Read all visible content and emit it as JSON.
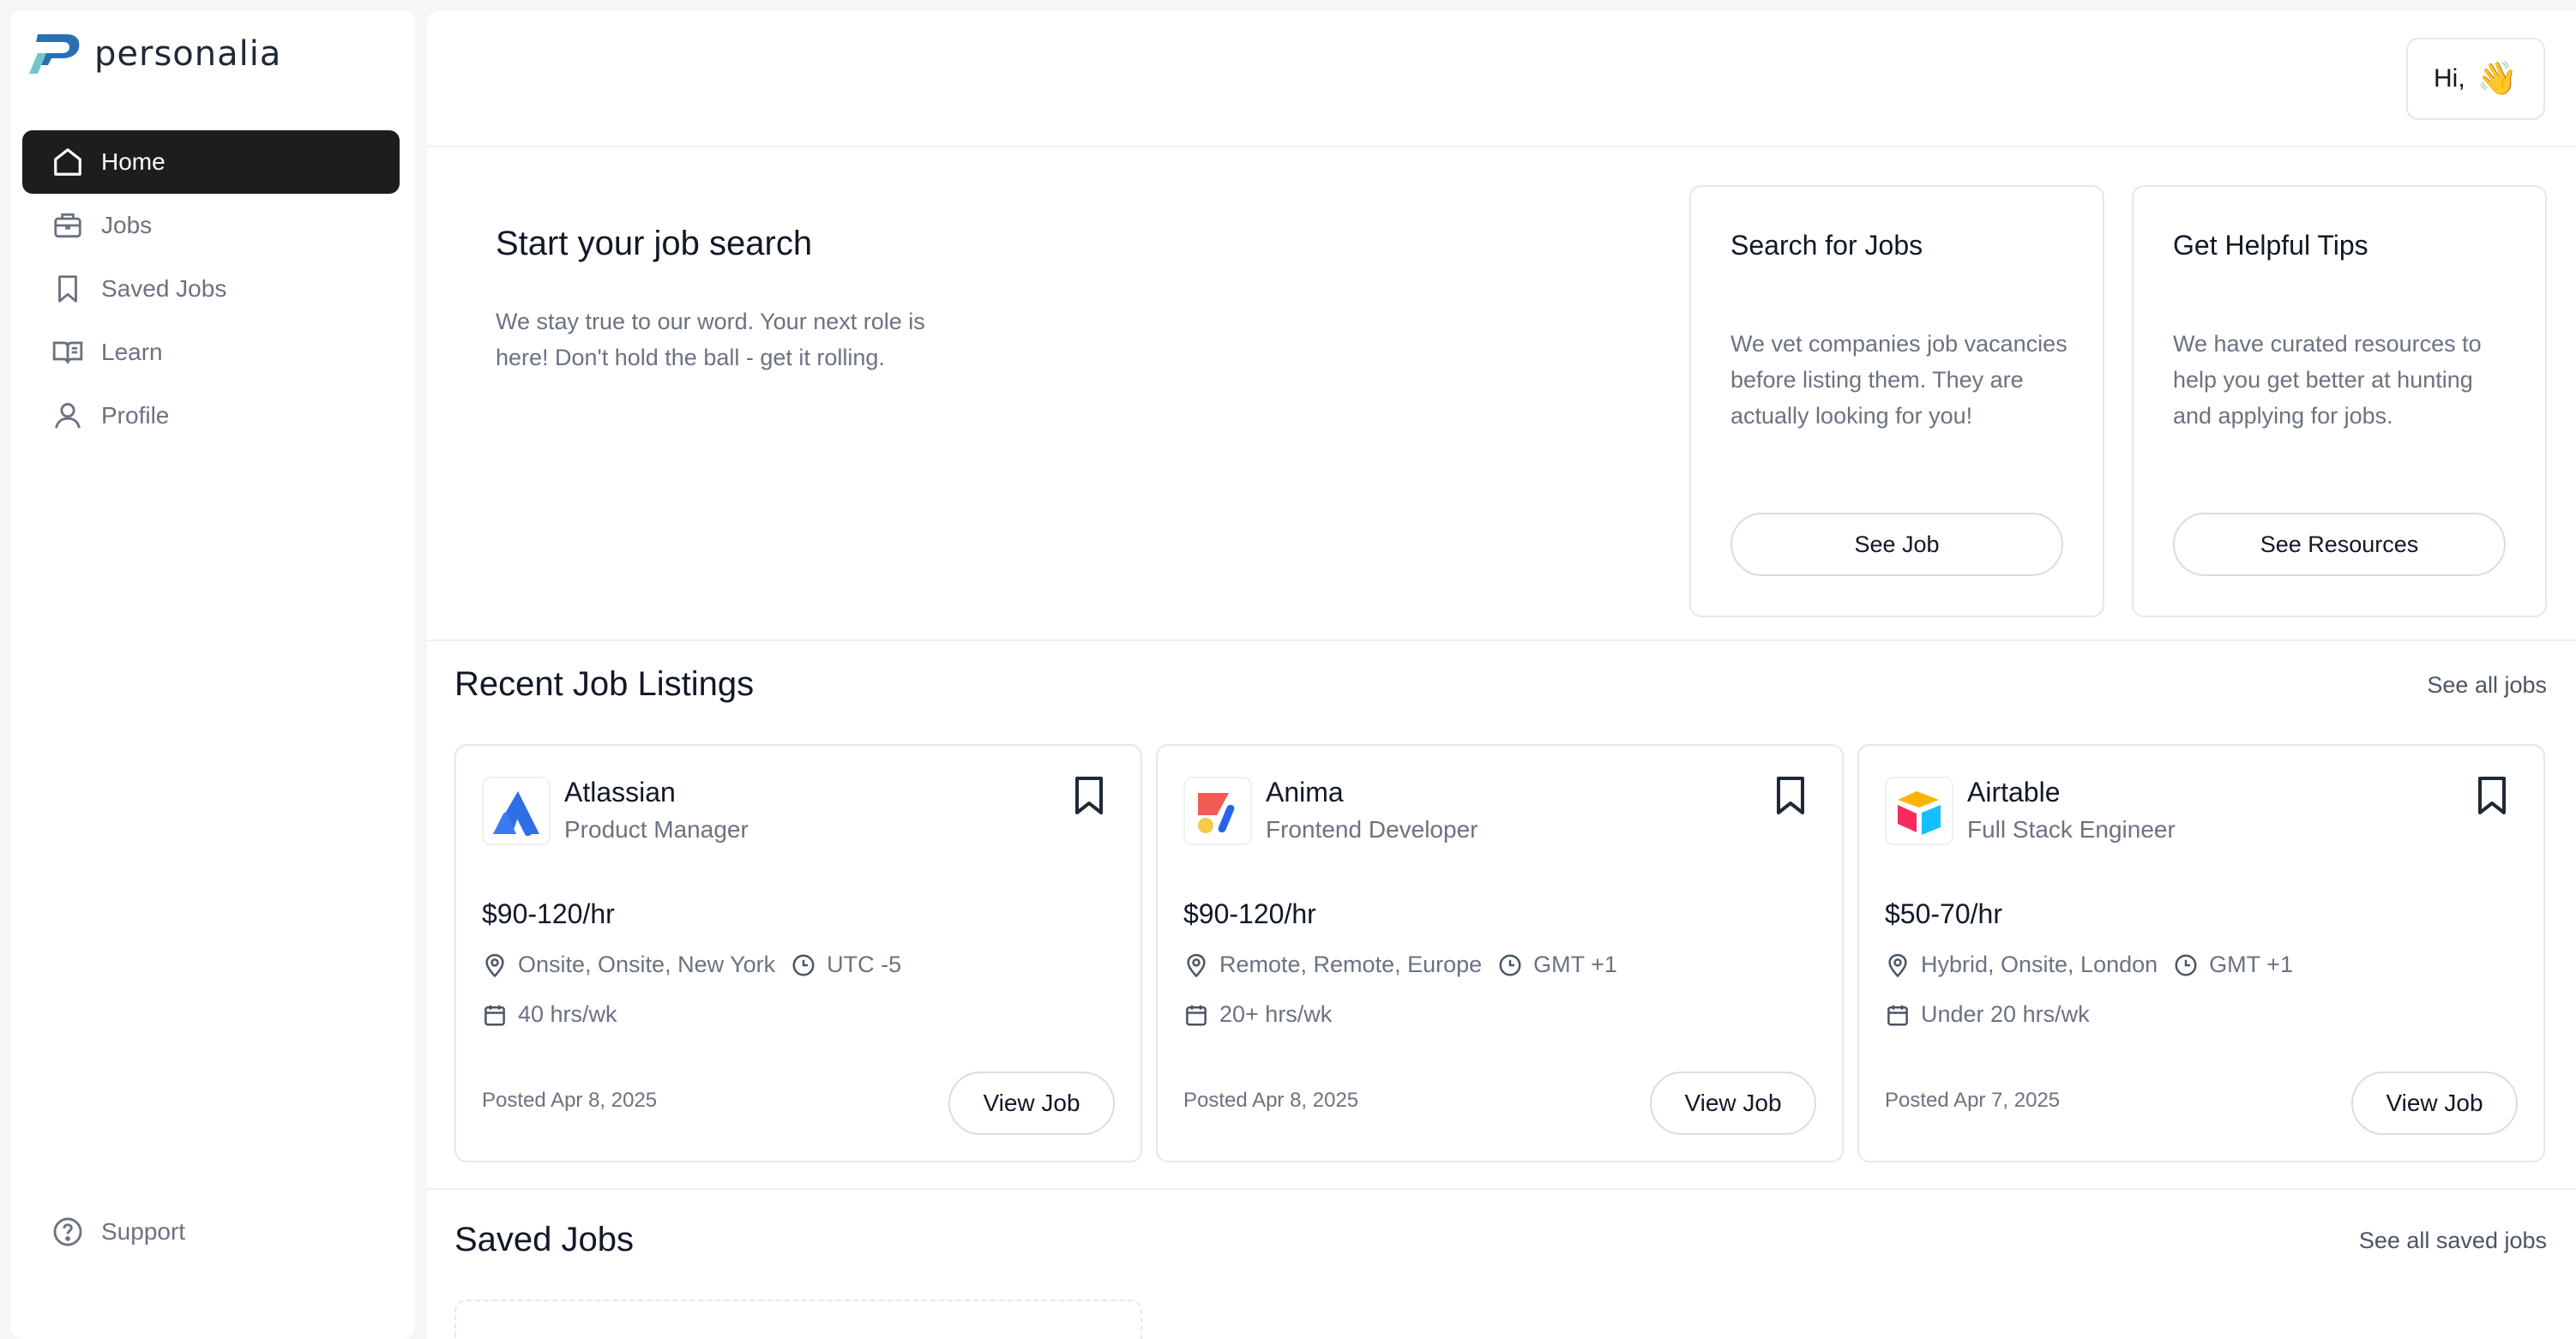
{
  "brand": {
    "name": "personalia"
  },
  "sidebar": {
    "items": [
      {
        "label": "Home",
        "icon": "home-icon",
        "active": true
      },
      {
        "label": "Jobs",
        "icon": "briefcase-icon"
      },
      {
        "label": "Saved Jobs",
        "icon": "bookmark-icon"
      },
      {
        "label": "Learn",
        "icon": "book-icon"
      },
      {
        "label": "Profile",
        "icon": "user-icon"
      }
    ],
    "support": {
      "label": "Support",
      "icon": "help-circle-icon"
    }
  },
  "header": {
    "greeting": "Hi,",
    "emoji": "👋"
  },
  "hero": {
    "title": "Start your job search",
    "description": "We stay true to our word. Your next role is here! Don't hold the ball - get it rolling."
  },
  "tips": [
    {
      "title": "Search for Jobs",
      "body": "We vet companies job vacancies before listing them. They are actually looking for you!",
      "button": "See Job"
    },
    {
      "title": "Get Helpful Tips",
      "body": "We have curated resources to help you get  better at hunting and applying for jobs.",
      "button": "See Resources"
    }
  ],
  "recent": {
    "title": "Recent Job Listings",
    "see_all": "See all jobs",
    "jobs": [
      {
        "company": "Atlassian",
        "role": "Product Manager",
        "rate": "$90-120/hr",
        "location": "Onsite, Onsite, New York",
        "timezone": "UTC -5",
        "hours": "40 hrs/wk",
        "posted": "Posted Apr 8, 2025",
        "button": "View Job",
        "logo": "atlassian-logo"
      },
      {
        "company": "Anima",
        "role": "Frontend Developer",
        "rate": "$90-120/hr",
        "location": "Remote, Remote, Europe",
        "timezone": "GMT +1",
        "hours": "20+ hrs/wk",
        "posted": "Posted Apr 8, 2025",
        "button": "View Job",
        "logo": "anima-logo"
      },
      {
        "company": "Airtable",
        "role": "Full Stack Engineer",
        "rate": "$50-70/hr",
        "location": "Hybrid, Onsite, London",
        "timezone": "GMT +1",
        "hours": "Under 20 hrs/wk",
        "posted": "Posted Apr 7, 2025",
        "button": "View Job",
        "logo": "airtable-logo"
      }
    ]
  },
  "saved": {
    "title": "Saved Jobs",
    "see_all": "See all saved jobs"
  },
  "colors": {
    "active_nav": "#1c1d1f",
    "muted_text": "#6b7280",
    "border": "#e5e7eb",
    "brand_blue": "#2a6fb5",
    "brand_teal": "#6fc6c8"
  }
}
